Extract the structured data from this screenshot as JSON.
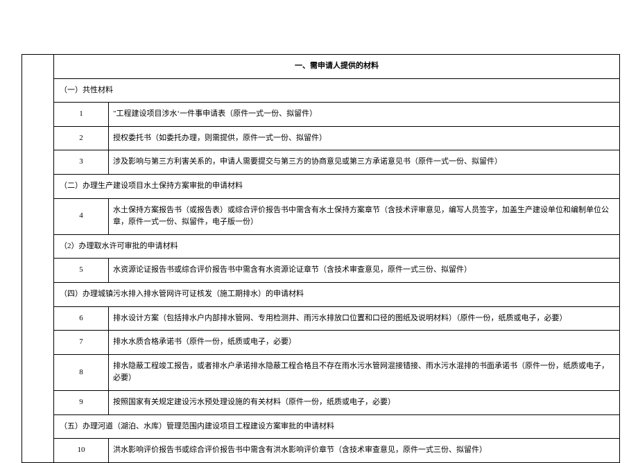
{
  "title": "一、需申请人提供的材料",
  "sections": {
    "s1": {
      "label": "（一）共性材料"
    },
    "s2": {
      "label": "（二）办理生产建设项目水土保持方案审批的申请材料"
    },
    "s3": {
      "label": "（2）办理取水许可审批的申请材料"
    },
    "s4": {
      "label": "（四）办理城镇污水排入排水管网许可证核发（施工期排水）的申请材料"
    },
    "s5": {
      "label": "（五）办理河道（湖泊、水库）管理范围内建设项目工程建设方案审批的申请材料"
    }
  },
  "rows": {
    "r1": {
      "num": "1",
      "text": "\"工程建设项目涉水‘一件事申请表（原件一式一份、拟留件）"
    },
    "r2": {
      "num": "2",
      "text": "授权委托书（如委托办理，则需提供，原件一式一份、拟留件）"
    },
    "r3": {
      "num": "3",
      "text": "涉及影响与第三方利害关系的，申请人需要提交与第三方的协商意见或第三方承诺意见书（原件一式一份、拟留件）"
    },
    "r4": {
      "num": "4",
      "text": "水土保持方案报告书（或报告表）或综合评价报告书中需含有水土保持方案章节（含技术评审意见，编写人员签字，加盖生产建设单位和编制单位公章，原件一式一份、拟留件，电子版一份）"
    },
    "r5": {
      "num": "5",
      "text": "水资源论证报告书或综合评价报告书中需含有水资源论证章节（含技术审查意见，原件一式三份、拟留件）"
    },
    "r6": {
      "num": "6",
      "text": "排水设计方案（包括排水户内部排水管网、专用检测井、雨污水排放口位置和口径的图纸及说明材料）（原件一份，纸质或电子，必要）"
    },
    "r7": {
      "num": "7",
      "text": "排水水质合格承诺书（原件一份，纸质或电子，必要）"
    },
    "r8": {
      "num": "8",
      "text": "排水隐蔽工程竣工报告，或者排水户承诺排水隐蔽工程合格且不存在雨水污水管网混接错接、雨水污水混排的书面承诺书（原件一份，纸质或电子，必要）"
    },
    "r9": {
      "num": "9",
      "text": "按照国家有关规定建设污水预处理设施的有关材料（原件一份，纸质或电子，必要）"
    },
    "r10": {
      "num": "10",
      "text": "洪水影响评价报告书或综合评价报告书中需含有洪水影响评价章节（含技术审查意见，原件一式三份、拟留件）"
    }
  }
}
